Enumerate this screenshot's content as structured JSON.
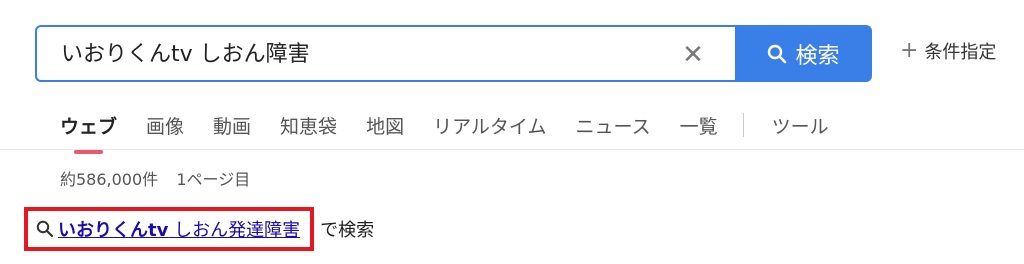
{
  "search": {
    "value": "いおりくんtv しおん障害",
    "clear_icon": "close-icon",
    "button_label": "検索",
    "button_icon": "search-icon",
    "advanced_label": "条件指定",
    "advanced_icon": "plus-icon"
  },
  "tabs": [
    {
      "label": "ウェブ",
      "active": true
    },
    {
      "label": "画像"
    },
    {
      "label": "動画"
    },
    {
      "label": "知恵袋"
    },
    {
      "label": "地図"
    },
    {
      "label": "リアルタイム"
    },
    {
      "label": "ニュース"
    },
    {
      "label": "一覧"
    },
    {
      "label": "ツール"
    }
  ],
  "results": {
    "count_text": "約586,000件",
    "page_text": "1ページ目"
  },
  "suggestion": {
    "icon": "search-icon",
    "bold_part": "いおりくんtv",
    "rest_part": " しおん発達障害",
    "suffix": "で検索"
  },
  "colors": {
    "accent": "#3a7fe8",
    "link": "#1a0dab",
    "highlight_border": "#e8161f",
    "active_tab_underline": "#e85a6b"
  }
}
